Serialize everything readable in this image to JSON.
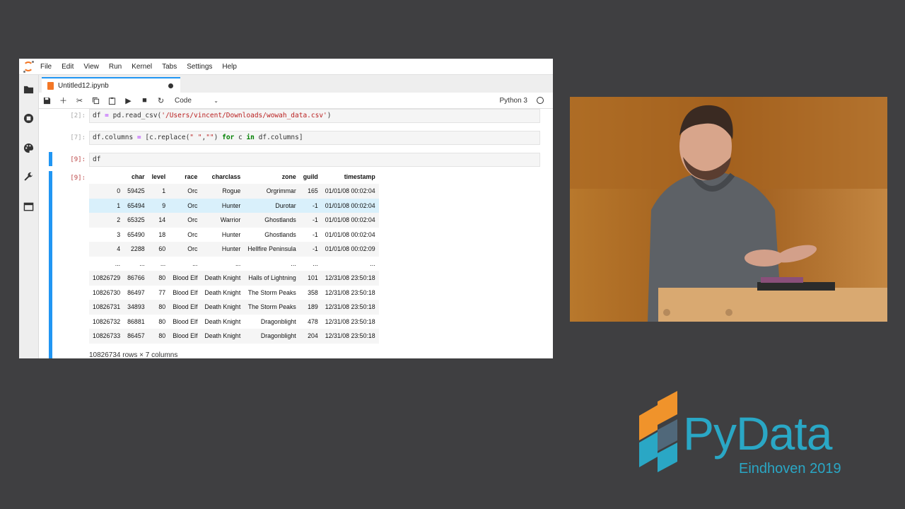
{
  "menubar": {
    "items": [
      "File",
      "Edit",
      "View",
      "Run",
      "Kernel",
      "Tabs",
      "Settings",
      "Help"
    ]
  },
  "tab": {
    "title": "Untitled12.ipynb"
  },
  "toolbar": {
    "cell_type": "Code",
    "kernel": "Python 3"
  },
  "cells": [
    {
      "prompt": "[2]:",
      "code_parts": [
        {
          "t": "df ",
          "c": ""
        },
        {
          "t": "=",
          "c": "op"
        },
        {
          "t": " pd.read_csv(",
          "c": ""
        },
        {
          "t": "'/Users/vincent/Downloads/wowah_data.csv'",
          "c": "str"
        },
        {
          "t": ")",
          "c": ""
        }
      ]
    },
    {
      "prompt": "[7]:",
      "code_parts": [
        {
          "t": "df.columns ",
          "c": ""
        },
        {
          "t": "=",
          "c": "op"
        },
        {
          "t": " [c.replace(",
          "c": ""
        },
        {
          "t": "\" \"",
          "c": "str"
        },
        {
          "t": ",",
          "c": ""
        },
        {
          "t": "\"\"",
          "c": "str"
        },
        {
          "t": ") ",
          "c": ""
        },
        {
          "t": "for",
          "c": "kw"
        },
        {
          "t": " c ",
          "c": ""
        },
        {
          "t": "in",
          "c": "kw"
        },
        {
          "t": " df.columns]",
          "c": ""
        }
      ]
    },
    {
      "prompt": "[9]:",
      "code_parts": [
        {
          "t": "df",
          "c": ""
        }
      ]
    }
  ],
  "output": {
    "prompt": "[9]:",
    "columns": [
      "",
      "char",
      "level",
      "race",
      "charclass",
      "zone",
      "guild",
      "timestamp"
    ],
    "rows": [
      [
        "0",
        "59425",
        "1",
        "Orc",
        "Rogue",
        "Orgrimmar",
        "165",
        "01/01/08 00:02:04"
      ],
      [
        "1",
        "65494",
        "9",
        "Orc",
        "Hunter",
        "Durotar",
        "-1",
        "01/01/08 00:02:04"
      ],
      [
        "2",
        "65325",
        "14",
        "Orc",
        "Warrior",
        "Ghostlands",
        "-1",
        "01/01/08 00:02:04"
      ],
      [
        "3",
        "65490",
        "18",
        "Orc",
        "Hunter",
        "Ghostlands",
        "-1",
        "01/01/08 00:02:04"
      ],
      [
        "4",
        "2288",
        "60",
        "Orc",
        "Hunter",
        "Hellfire Peninsula",
        "-1",
        "01/01/08 00:02:09"
      ],
      [
        "...",
        "...",
        "...",
        "...",
        "...",
        "...",
        "...",
        "..."
      ],
      [
        "10826729",
        "86766",
        "80",
        "Blood Elf",
        "Death Knight",
        "Halls of Lightning",
        "101",
        "12/31/08 23:50:18"
      ],
      [
        "10826730",
        "86497",
        "77",
        "Blood Elf",
        "Death Knight",
        "The Storm Peaks",
        "358",
        "12/31/08 23:50:18"
      ],
      [
        "10826731",
        "34893",
        "80",
        "Blood Elf",
        "Death Knight",
        "The Storm Peaks",
        "189",
        "12/31/08 23:50:18"
      ],
      [
        "10826732",
        "86881",
        "80",
        "Blood Elf",
        "Death Knight",
        "Dragonblight",
        "478",
        "12/31/08 23:50:18"
      ],
      [
        "10826733",
        "86457",
        "80",
        "Blood Elf",
        "Death Knight",
        "Dragonblight",
        "204",
        "12/31/08 23:50:18"
      ]
    ],
    "highlighted_row": 1,
    "shape": "10826734 rows × 7 columns"
  },
  "logo": {
    "name": "PyData",
    "event": "Eindhoven 2019"
  },
  "colors": {
    "jupyter_orange": "#f37726",
    "active_blue": "#2196f3",
    "pydata_orange": "#f0932b",
    "pydata_teal": "#2aa7c5",
    "pydata_slate": "#50687a"
  }
}
